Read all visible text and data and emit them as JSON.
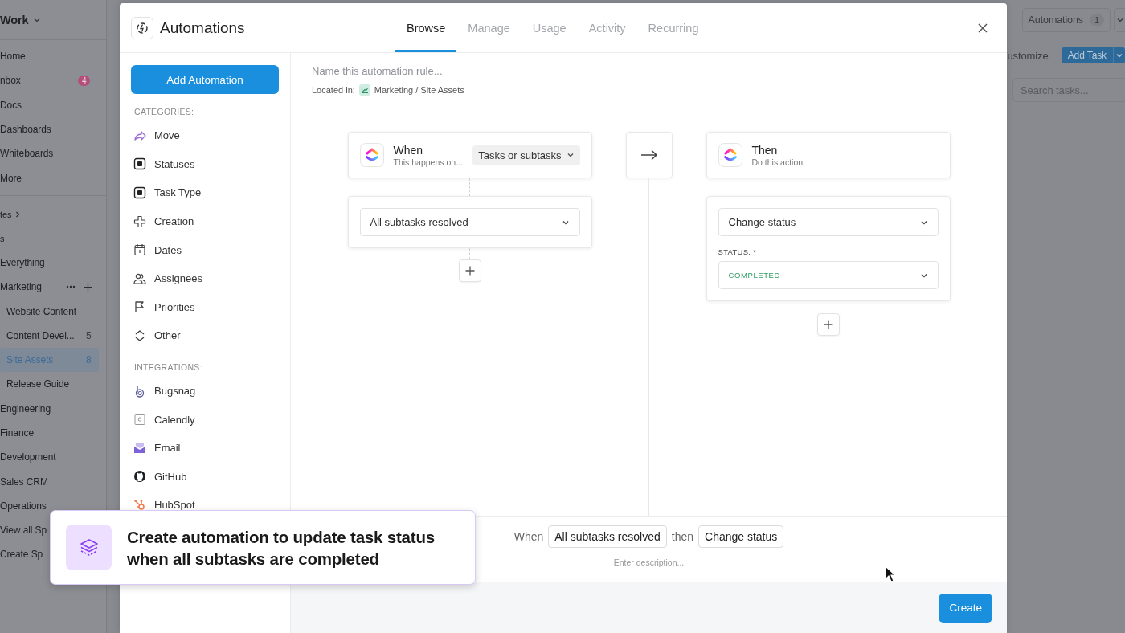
{
  "sidebar": {
    "workspace": "Work",
    "items": [
      {
        "label": "Home"
      },
      {
        "label": "nbox",
        "badge": "4"
      },
      {
        "label": "Docs"
      },
      {
        "label": "Dashboards"
      },
      {
        "label": "Whiteboards"
      },
      {
        "label": "More"
      }
    ],
    "sections": [
      "tes",
      "s"
    ],
    "spaces": [
      {
        "label": "Everything",
        "selected": false
      },
      {
        "label": "Marketing",
        "selected": false,
        "children": [
          {
            "label": "Website Content",
            "selected": false
          },
          {
            "label": "Content Devel...",
            "count": "5",
            "selected": false
          },
          {
            "label": "Site Assets",
            "count": "8",
            "selected": true
          },
          {
            "label": "Release Guide",
            "selected": false
          }
        ]
      },
      {
        "label": "Engineering",
        "selected": false
      },
      {
        "label": "Finance",
        "selected": false
      },
      {
        "label": "Development",
        "selected": false
      },
      {
        "label": "Sales CRM",
        "selected": false
      },
      {
        "label": "Operations",
        "selected": false
      },
      {
        "label": "View all Sp",
        "selected": false
      },
      {
        "label": "Create Sp",
        "selected": false
      }
    ]
  },
  "toolbar": {
    "automations": "Automations",
    "automations_count": "1",
    "customize": "ustomize",
    "add_task": "Add Task",
    "search_placeholder": "Search tasks..."
  },
  "modal": {
    "title": "Automations",
    "tabs": [
      {
        "label": "Browse",
        "selected": true
      },
      {
        "label": "Manage",
        "selected": false
      },
      {
        "label": "Usage",
        "selected": false
      },
      {
        "label": "Activity",
        "selected": false
      },
      {
        "label": "Recurring",
        "selected": false
      }
    ],
    "add_button": "Add Automation",
    "categories_heading": "CATEGORIES:",
    "categories": [
      "Move",
      "Statuses",
      "Task Type",
      "Creation",
      "Dates",
      "Assignees",
      "Priorities",
      "Other"
    ],
    "integrations_heading": "INTEGRATIONS:",
    "integrations": [
      "Bugsnag",
      "Calendly",
      "Email",
      "GitHub",
      "HubSpot"
    ],
    "name_placeholder": "Name this automation rule...",
    "location_label": "Located in:",
    "location": "Marketing / Site Assets",
    "trigger": {
      "title": "When",
      "subtitle": "This happens on...",
      "scope": "Tasks or subtasks",
      "condition": "All subtasks resolved"
    },
    "action": {
      "title": "Then",
      "subtitle": "Do this action",
      "action": "Change status",
      "field_label": "STATUS: *",
      "status": "COMPLETED"
    },
    "summary": {
      "when": "When",
      "trigger": "All subtasks resolved",
      "then": "then",
      "action": "Change status",
      "description_placeholder": "Enter description..."
    },
    "create_button": "Create"
  },
  "callout": {
    "text": "Create automation to update task status when all subtasks are completed"
  }
}
